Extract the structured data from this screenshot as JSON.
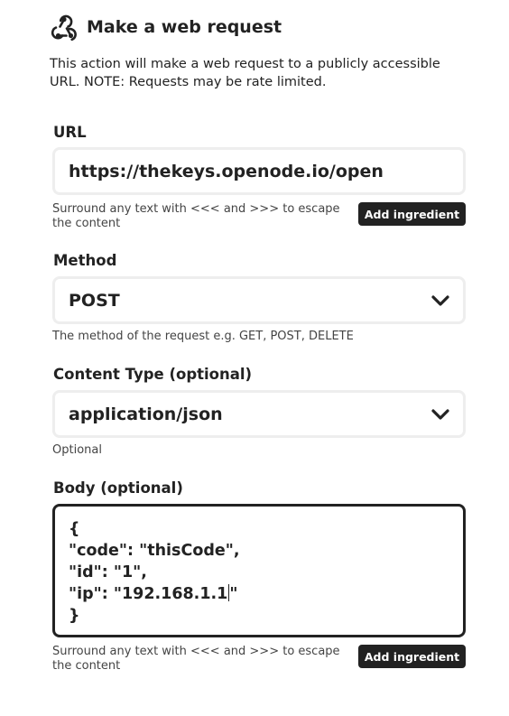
{
  "header": {
    "title": "Make a web request",
    "icon": "webhook-icon"
  },
  "description": "This action will make a web request to a publicly accessible URL. NOTE: Requests may be rate limited.",
  "url": {
    "label": "URL",
    "value": "https://thekeys.openode.io/open",
    "helper": "Surround any text with <<< and >>> to escape the content",
    "add_ingredient_label": "Add ingredient"
  },
  "method": {
    "label": "Method",
    "selected": "POST",
    "helper": "The method of the request e.g. GET, POST, DELETE"
  },
  "content_type": {
    "label": "Content Type (optional)",
    "selected": "application/json",
    "helper": "Optional"
  },
  "body": {
    "label": "Body (optional)",
    "lines": [
      "{",
      "\"code\": \"thisCode\",",
      "\"id\": \"1\",",
      "\"ip\": \"192.168.1.1",
      "\"",
      "}"
    ],
    "helper": "Surround any text with <<< and >>> to escape the content",
    "add_ingredient_label": "Add ingredient"
  },
  "colors": {
    "text": "#222222",
    "field_border": "#eeeeee",
    "active_border": "#222222",
    "button_bg": "#222222",
    "button_text": "#ffffff"
  }
}
